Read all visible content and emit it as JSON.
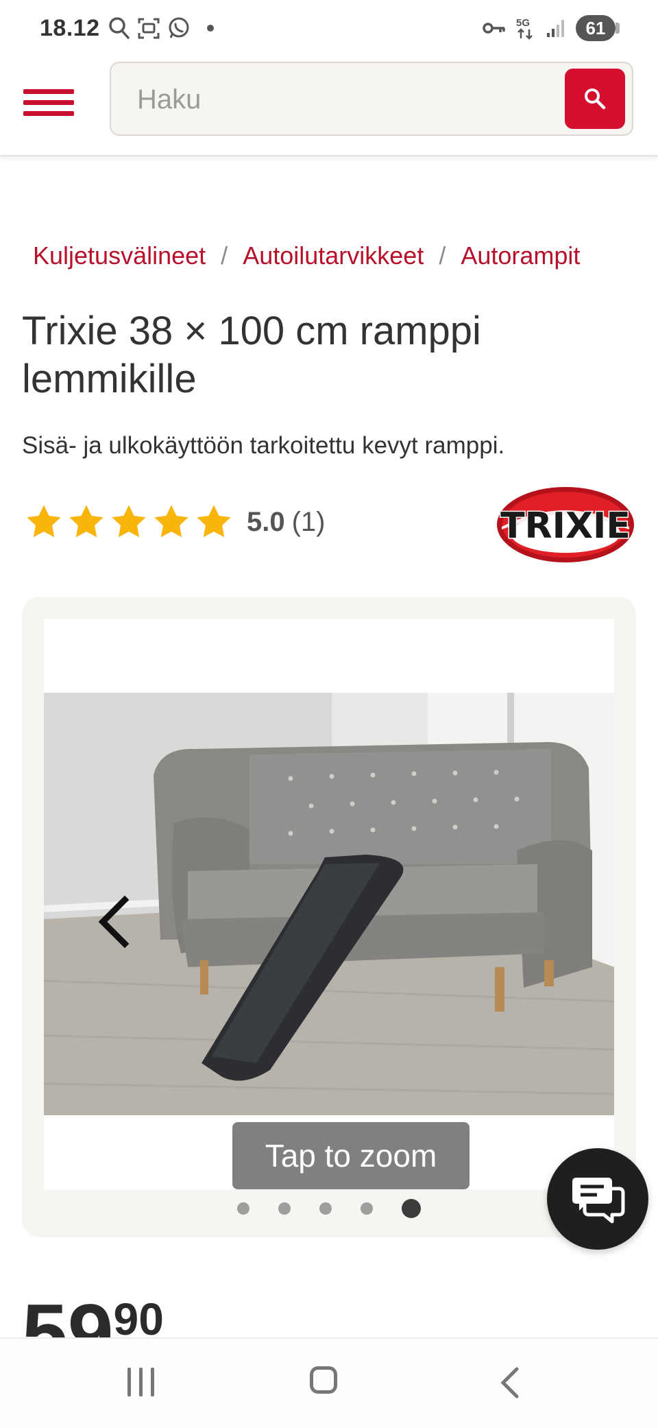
{
  "status_bar": {
    "time": "18.12",
    "battery": "61",
    "network": "5G"
  },
  "header": {
    "search_placeholder": "Haku"
  },
  "breadcrumb": [
    {
      "label": "Kuljetusvälineet"
    },
    {
      "label": "Autoilutarvikkeet"
    },
    {
      "label": "Autorampit"
    }
  ],
  "breadcrumb_separator": "/",
  "product": {
    "title": "Trixie 38 × 100 cm ramppi lemmikille",
    "subtitle": "Sisä- ja ulkokäyttöön tarkoitettu kevyt ramppi.",
    "rating": "5.0",
    "rating_count": "(1)",
    "stars": 5,
    "brand": "TRIXIE",
    "price_euros": "59",
    "price_cents": "90"
  },
  "gallery": {
    "zoom_hint": "Tap to zoom",
    "image_count": 5,
    "active_index": 5
  },
  "colors": {
    "accent": "#c8102e",
    "star": "#f9b50b",
    "gallery_bg": "#f6f5f1"
  },
  "icons": [
    "search-icon",
    "menu-icon",
    "chevron-left-icon",
    "chat-icon",
    "star-icon",
    "key-icon",
    "whatsapp-icon",
    "signal-icon"
  ]
}
